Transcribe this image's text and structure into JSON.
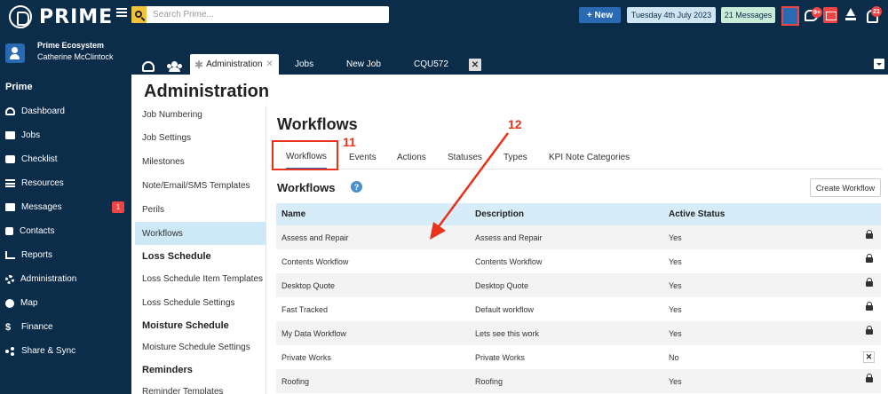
{
  "app": {
    "logo_text": "PRIME"
  },
  "search": {
    "placeholder": "Search Prime..."
  },
  "topbar": {
    "new_label": "New",
    "date": "Tuesday 4th July 2023",
    "messages": "21 Messages",
    "chat_count": "9+",
    "bell_count": "21"
  },
  "user": {
    "org": "Prime Ecosystem",
    "name": "Catherine McClintock"
  },
  "sidebar": {
    "section": "Prime",
    "items": [
      {
        "label": "Dashboard",
        "icon": "dashboard-icon"
      },
      {
        "label": "Jobs",
        "icon": "folder-icon"
      },
      {
        "label": "Checklist",
        "icon": "checklist-icon"
      },
      {
        "label": "Resources",
        "icon": "resources-icon"
      },
      {
        "label": "Messages",
        "icon": "mail-icon",
        "count": "1"
      },
      {
        "label": "Contacts",
        "icon": "contact-icon"
      },
      {
        "label": "Reports",
        "icon": "chart-icon"
      },
      {
        "label": "Administration",
        "icon": "gear-icon"
      },
      {
        "label": "Map",
        "icon": "map-icon"
      },
      {
        "label": "Finance",
        "icon": "dollar-icon"
      },
      {
        "label": "Share & Sync",
        "icon": "share-icon"
      }
    ]
  },
  "tabs": {
    "active": "Administration",
    "items": [
      "Jobs",
      "New Job",
      "CQU572"
    ]
  },
  "page": {
    "title": "Administration"
  },
  "settings_menu": {
    "items_top": [
      "Job Numbering",
      "Job Settings",
      "Milestones",
      "Note/Email/SMS Templates",
      "Perils",
      "Workflows"
    ],
    "selected": "Workflows",
    "loss_heading": "Loss Schedule",
    "loss_items": [
      "Loss Schedule Item Templates",
      "Loss Schedule Settings"
    ],
    "moisture_heading": "Moisture Schedule",
    "moisture_items": [
      "Moisture Schedule Settings"
    ],
    "reminders_heading": "Reminders",
    "reminders_items": [
      "Reminder Templates"
    ]
  },
  "content": {
    "title": "Workflows",
    "subtabs": [
      "Workflows",
      "Events",
      "Actions",
      "Statuses",
      "Types",
      "KPI Note Categories"
    ],
    "section_title": "Workflows",
    "help": "?",
    "create_label": "Create Workflow"
  },
  "table": {
    "headers": [
      "Name",
      "Description",
      "Active Status"
    ],
    "rows": [
      {
        "name": "Assess and Repair",
        "description": "Assess and Repair",
        "status": "Yes",
        "action": "lock"
      },
      {
        "name": "Contents Workflow",
        "description": "Contents Workflow",
        "status": "Yes",
        "action": "lock"
      },
      {
        "name": "Desktop Quote",
        "description": "Desktop Quote",
        "status": "Yes",
        "action": "lock"
      },
      {
        "name": "Fast Tracked",
        "description": "Default workflow",
        "status": "Yes",
        "action": "lock"
      },
      {
        "name": "My Data Workflow",
        "description": "Lets see this work",
        "status": "Yes",
        "action": "lock"
      },
      {
        "name": "Private Works",
        "description": "Private Works",
        "status": "No",
        "action": "delete"
      },
      {
        "name": "Roofing",
        "description": "Roofing",
        "status": "Yes",
        "action": "lock"
      }
    ]
  },
  "annotations": {
    "box_label": "11",
    "arrow_label": "12",
    "color": "#e8321c"
  },
  "colors": {
    "nav_bg": "#0c2d4a",
    "accent": "#2a6ab3",
    "selected_row": "#cde8f6",
    "table_header": "#d6ecf8",
    "badge_red": "#e44"
  }
}
